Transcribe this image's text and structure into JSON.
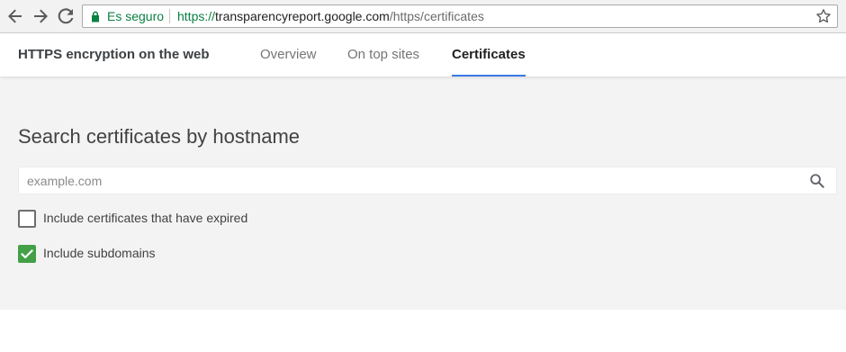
{
  "browser": {
    "secure_label": "Es seguro",
    "url": {
      "scheme": "https://",
      "host": "transparencyreport.google.com",
      "path": "/https/certificates"
    },
    "icons": [
      "back-arrow-icon",
      "forward-arrow-icon",
      "reload-icon",
      "lock-icon",
      "star-icon"
    ]
  },
  "header": {
    "title": "HTTPS encryption on the web",
    "tabs": [
      {
        "label": "Overview",
        "active": false
      },
      {
        "label": "On top sites",
        "active": false
      },
      {
        "label": "Certificates",
        "active": true
      }
    ]
  },
  "main": {
    "title": "Search certificates by hostname",
    "search": {
      "placeholder": "example.com",
      "value": "",
      "icon": "search-icon"
    },
    "options": [
      {
        "label": "Include certificates that have expired",
        "checked": false
      },
      {
        "label": "Include subdomains",
        "checked": true
      }
    ]
  },
  "colors": {
    "secure_green": "#0b8043",
    "tab_underline": "#3b78e7",
    "checkbox_checked": "#43a047",
    "panel_background": "#f3f3f3"
  }
}
